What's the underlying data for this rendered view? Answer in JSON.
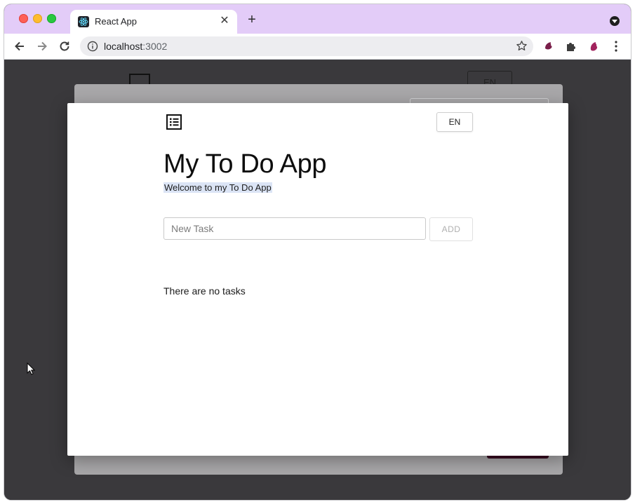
{
  "browser": {
    "tab": {
      "title": "React App",
      "favicon": "react-icon",
      "close_icon": "close-icon"
    },
    "new_tab_icon": "plus-icon",
    "address_bar": {
      "host": "localhost",
      "port": ":3002"
    },
    "toolbar_icons": [
      "back-arrow-icon",
      "forward-arrow-icon",
      "reload-icon",
      "info-icon",
      "star-icon",
      "extension-icon",
      "puzzle-icon",
      "kebab-menu-icon"
    ]
  },
  "background_page": {
    "lang_button": "EN"
  },
  "app": {
    "logo_icon": "list-icon",
    "lang_button": "EN",
    "title": "My To Do App",
    "subtitle": "Welcome to my To Do App",
    "new_task_placeholder": "New Task",
    "new_task_value": "",
    "add_button": "ADD",
    "empty_message": "There are no tasks"
  }
}
